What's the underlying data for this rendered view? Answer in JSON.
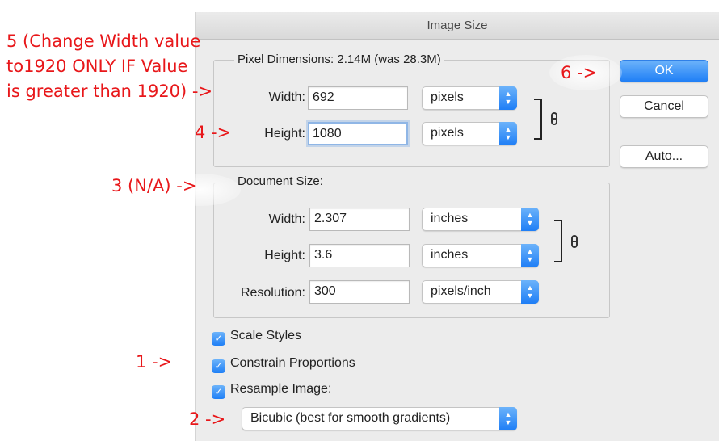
{
  "dialog": {
    "title": "Image Size",
    "buttons": {
      "ok": "OK",
      "cancel": "Cancel",
      "auto": "Auto..."
    }
  },
  "pixel_dimensions": {
    "legend": "Pixel Dimensions: 2.14M (was 28.3M)",
    "width": {
      "label": "Width:",
      "value": "692",
      "unit": "pixels"
    },
    "height": {
      "label": "Height:",
      "value": "1080",
      "unit": "pixels"
    }
  },
  "document_size": {
    "legend": "Document Size:",
    "width": {
      "label": "Width:",
      "value": "2.307",
      "unit": "inches"
    },
    "height": {
      "label": "Height:",
      "value": "3.6",
      "unit": "inches"
    },
    "resolution": {
      "label": "Resolution:",
      "value": "300",
      "unit": "pixels/inch"
    }
  },
  "options": {
    "scale_styles": {
      "label": "Scale Styles",
      "checked": true
    },
    "constrain_proportions": {
      "label": "Constrain Proportions",
      "checked": true
    },
    "resample_image": {
      "label": "Resample Image:",
      "checked": true
    },
    "resample_method": "Bicubic (best for smooth gradients)"
  },
  "annotations": {
    "step5_line1": "5 (Change Width value",
    "step5_line2": "to1920 ONLY IF Value",
    "step5_line3": "is greater than 1920)  ->",
    "step6": "6 ->",
    "step4": "4 ->",
    "step3": "3 (N/A) ->",
    "step1": "1 ->",
    "step2": "2 ->"
  },
  "colors": {
    "annotation": "#e8171a",
    "accent": "#1f7ff6"
  }
}
